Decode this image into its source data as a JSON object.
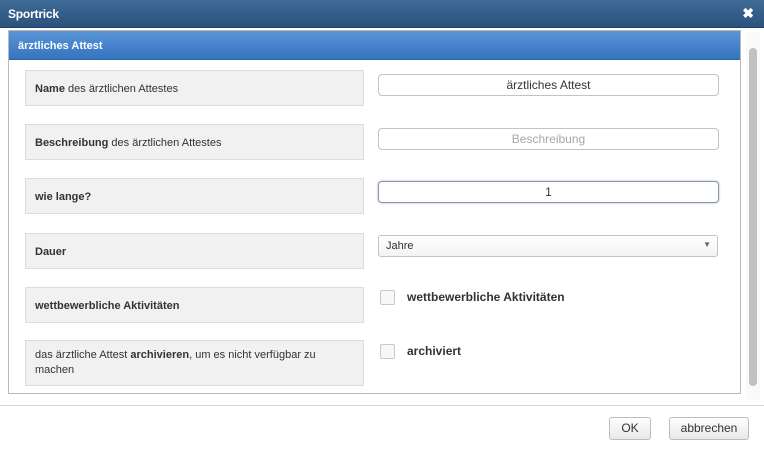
{
  "window": {
    "title": "Sportrick",
    "close_glyph": "✖"
  },
  "panel": {
    "title": "ärztliches Attest"
  },
  "fields": {
    "name": {
      "label_bold": "Name",
      "label_rest": " des ärztlichen Attestes",
      "value": "ärztliches Attest"
    },
    "description": {
      "label_bold": "Beschreibung",
      "label_rest": " des ärztlichen Attestes",
      "placeholder": "Beschreibung"
    },
    "how_long": {
      "label_bold": "wie lange?",
      "value": "1"
    },
    "duration": {
      "label_bold": "Dauer",
      "selected": "Jahre"
    },
    "competitive": {
      "label_bold": "wettbewerbliche Aktivitäten",
      "checkbox_label": "wettbewerbliche Aktivitäten",
      "checked": false
    },
    "archive": {
      "label_pre": "das ärztliche Attest ",
      "label_bold": "archivieren",
      "label_post": ", um es nicht verfügbar zu machen",
      "checkbox_label": "archiviert",
      "checked": false
    }
  },
  "footer": {
    "ok_label": "OK",
    "cancel_label": "abbrechen"
  },
  "icons": {
    "close": "close-icon",
    "select_caret": "chevron-down-icon"
  }
}
